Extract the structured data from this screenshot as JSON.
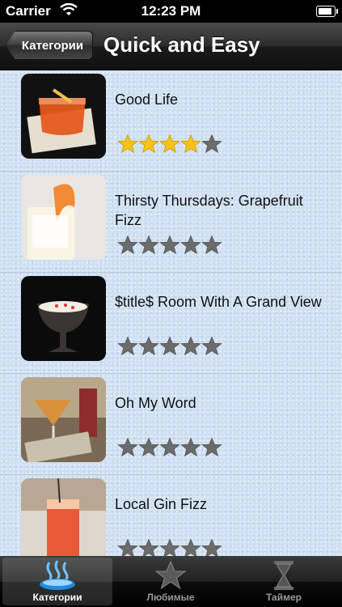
{
  "status": {
    "carrier": "Carrier",
    "time": "12:23 PM"
  },
  "nav": {
    "back_label": "Категории",
    "title": "Quick and Easy"
  },
  "items": [
    {
      "title": "Good Life",
      "rating": 4,
      "max": 5
    },
    {
      "title": "Thirsty Thursdays: Grapefruit Fizz",
      "rating": 0,
      "max": 5
    },
    {
      "title": "$title$ Room With A Grand View",
      "rating": 0,
      "max": 5
    },
    {
      "title": "Oh My Word",
      "rating": 0,
      "max": 5
    },
    {
      "title": "Local Gin Fizz",
      "rating": 0,
      "max": 5
    }
  ],
  "tabs": [
    {
      "label": "Категории",
      "icon": "steam-bowl-icon",
      "active": true
    },
    {
      "label": "Любимые",
      "icon": "star-icon",
      "active": false
    },
    {
      "label": "Таймер",
      "icon": "hourglass-icon",
      "active": false
    }
  ],
  "colors": {
    "star_gold": "#f7c316",
    "star_gray": "#6b6b6b",
    "tab_accent": "#2f9fe8"
  }
}
